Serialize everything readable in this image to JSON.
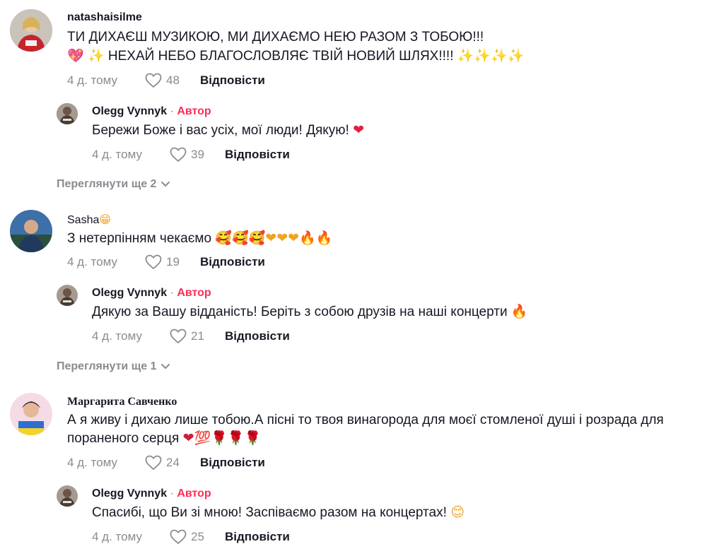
{
  "common": {
    "author_label": "Автор",
    "reply_label": "Відповісти",
    "separator": " · "
  },
  "comments": [
    {
      "username": "natashaisilme",
      "line1": "ТИ ДИХАЄШ МУЗИКОЮ, МИ ДИХАЄМО НЕЮ РАЗОМ З ТОБОЮ!!!",
      "line2_emoji_start": "💖 ✨",
      "line2": "НЕХАЙ НЕБО БЛАГОСЛОВЛЯЄ ТВІЙ НОВИЙ ШЛЯХ!!!!",
      "line2_emoji_end": "✨✨✨✨",
      "date": "4 д. тому",
      "likes": "48",
      "reply": {
        "username": "Olegg Vynnyk",
        "text": "Бережи Боже і вас усіх, мої люди! Дякую!",
        "emoji": "❤",
        "date": "4 д. тому",
        "likes": "39"
      },
      "view_more": "Переглянути ще 2"
    },
    {
      "username": "Sasha",
      "username_emoji": "😁",
      "text": "З нетерпінням чекаємо",
      "emoji": "🥰🥰🥰❤❤❤🔥🔥",
      "date": "4 д. тому",
      "likes": "19",
      "reply": {
        "username": "Olegg Vynnyk",
        "text": "Дякую за Вашу відданість! Беріть з собою друзів на наші концерти",
        "emoji": "🔥",
        "date": "4 д. тому",
        "likes": "21"
      },
      "view_more": "Переглянути ще 1"
    },
    {
      "username": "Маргарита Савченко",
      "line1": "А я живу і дихаю лише тобою.А пісні то твоя винагорода для моєї стомленої душі і розрада для",
      "line2": "пораненого серця",
      "emoji": "❤💯🌹🌹🌹",
      "date": "4 д. тому",
      "likes": "24",
      "reply": {
        "username": "Olegg Vynnyk",
        "text": "Спасибі, що Ви зі мною! Заспіваємо разом на концертах!",
        "emoji": "😊",
        "date": "4 д. тому",
        "likes": "25"
      }
    }
  ],
  "colors": {
    "author_accent": "#fe2c55",
    "muted": "#8a8b91",
    "text": "#161823"
  }
}
